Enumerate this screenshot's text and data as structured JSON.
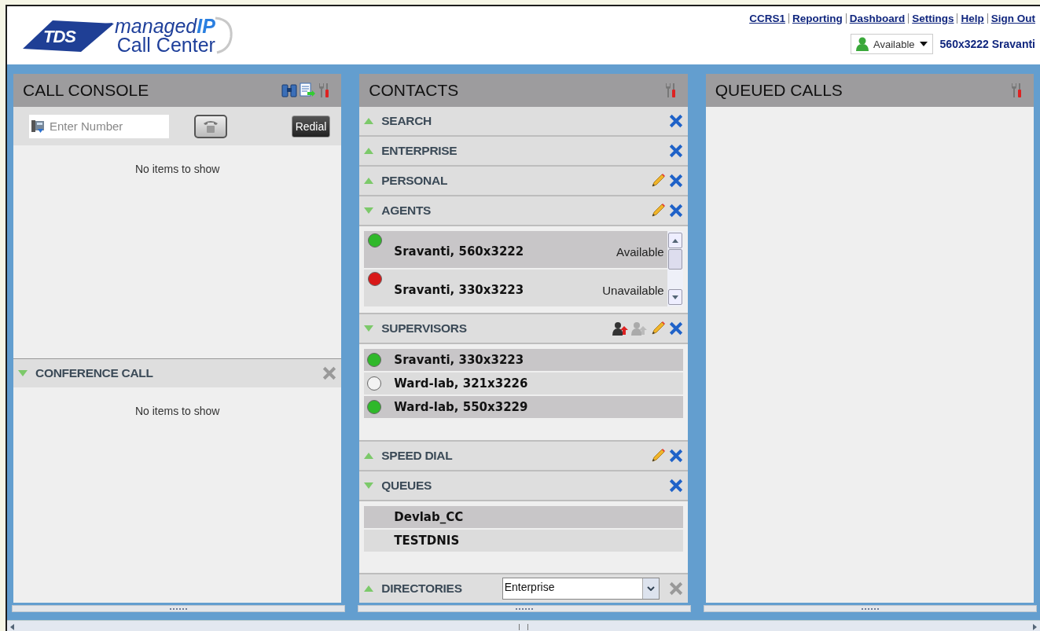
{
  "header": {
    "logo": {
      "badge": "TDS",
      "line_1": "managed**IP**",
      "line_2": "Call Center"
    },
    "links": [
      "CCRS1",
      "Reporting",
      "Dashboard",
      "Settings",
      "Help",
      "Sign Out"
    ],
    "status": {
      "value": "Available"
    },
    "user": "560x3222 Sravanti"
  },
  "call_console": {
    "title": "CALL CONSOLE",
    "number_field": {
      "placeholder": "Enter Number"
    },
    "redial_button": "Redial",
    "empty_text": "No items to show",
    "conference": {
      "title": "CONFERENCE CALL",
      "expanded": true,
      "close_enabled": false,
      "empty_text": "No items to show"
    }
  },
  "contacts": {
    "title": "CONTACTS",
    "sections": [
      {
        "title": "SEARCH",
        "expanded": false,
        "editable": false,
        "close_enabled": true
      },
      {
        "title": "ENTERPRISE",
        "expanded": false,
        "editable": false,
        "close_enabled": true
      },
      {
        "title": "PERSONAL",
        "expanded": false,
        "editable": true,
        "close_enabled": true
      },
      {
        "title": "AGENTS",
        "expanded": true,
        "editable": true,
        "close_enabled": true,
        "kind": "agents",
        "items": [
          {
            "name": "Sravanti, 560x3222",
            "status": "Available",
            "color": "#2fb82a"
          },
          {
            "name": "Sravanti, 330x3223",
            "status": "Unavailable",
            "color": "#d81818"
          }
        ]
      },
      {
        "title": "SUPERVISORS",
        "expanded": true,
        "editable": true,
        "close_enabled": true,
        "kind": "supervisors",
        "items": [
          {
            "name": "Sravanti, 330x3223",
            "color": "#2fb82a"
          },
          {
            "name": "Ward-lab, 321x3226",
            "color": "#f2f2f2"
          },
          {
            "name": "Ward-lab, 550x3229",
            "color": "#2fb82a"
          }
        ]
      },
      {
        "title": "SPEED DIAL",
        "expanded": false,
        "editable": true,
        "close_enabled": true
      },
      {
        "title": "QUEUES",
        "expanded": true,
        "editable": false,
        "close_enabled": true,
        "kind": "queues",
        "items": [
          {
            "name": "Devlab_CC"
          },
          {
            "name": "TESTDNIS"
          }
        ]
      }
    ],
    "directories": {
      "title": "DIRECTORIES",
      "expanded": false,
      "value": "Enterprise",
      "close_enabled": false
    }
  },
  "queued_calls": {
    "title": "QUEUED CALLS"
  }
}
